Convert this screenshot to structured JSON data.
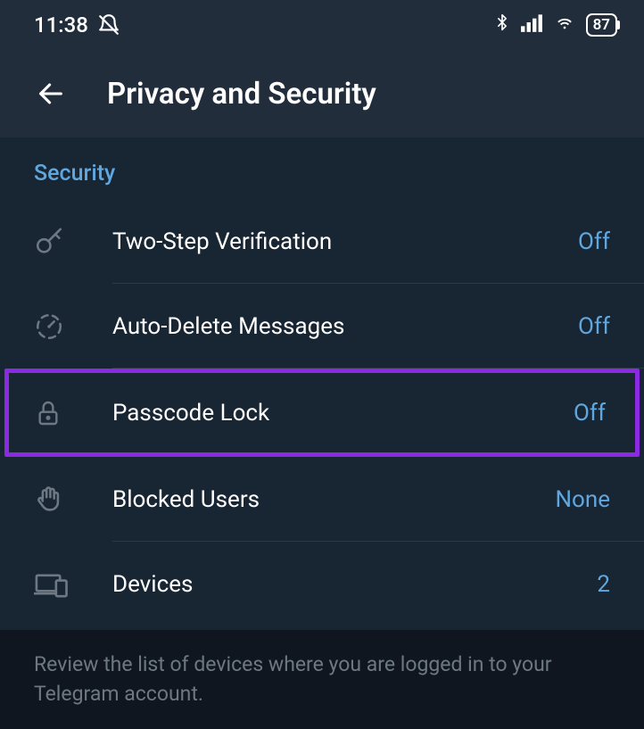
{
  "status": {
    "time": "11:38",
    "battery": "87"
  },
  "header": {
    "title": "Privacy and Security"
  },
  "section": {
    "title": "Security"
  },
  "rows": {
    "two_step": {
      "label": "Two-Step Verification",
      "value": "Off"
    },
    "auto_delete": {
      "label": "Auto-Delete Messages",
      "value": "Off"
    },
    "passcode": {
      "label": "Passcode Lock",
      "value": "Off"
    },
    "blocked": {
      "label": "Blocked Users",
      "value": "None"
    },
    "devices": {
      "label": "Devices",
      "value": "2"
    }
  },
  "footer": {
    "text": "Review the list of devices where you are logged in to your Telegram account."
  }
}
